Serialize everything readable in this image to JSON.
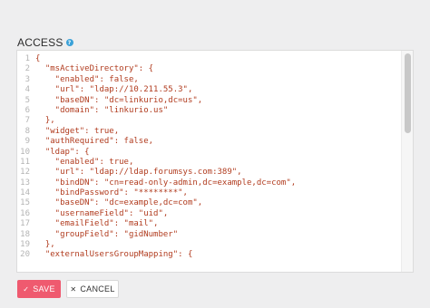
{
  "section": {
    "title": "ACCESS",
    "help_icon": "?"
  },
  "editor": {
    "lines": [
      {
        "n": "1",
        "text": "{"
      },
      {
        "n": "2",
        "text": "  \"msActiveDirectory\": {"
      },
      {
        "n": "3",
        "text": "    \"enabled\": false,"
      },
      {
        "n": "4",
        "text": "    \"url\": \"ldap://10.211.55.3\","
      },
      {
        "n": "5",
        "text": "    \"baseDN\": \"dc=linkurio,dc=us\","
      },
      {
        "n": "6",
        "text": "    \"domain\": \"linkurio.us\""
      },
      {
        "n": "7",
        "text": "  },"
      },
      {
        "n": "8",
        "text": "  \"widget\": true,"
      },
      {
        "n": "9",
        "text": "  \"authRequired\": false,"
      },
      {
        "n": "10",
        "text": "  \"ldap\": {"
      },
      {
        "n": "11",
        "text": "    \"enabled\": true,"
      },
      {
        "n": "12",
        "text": "    \"url\": \"ldap://ldap.forumsys.com:389\","
      },
      {
        "n": "13",
        "text": "    \"bindDN\": \"cn=read-only-admin,dc=example,dc=com\","
      },
      {
        "n": "14",
        "text": "    \"bindPassword\": \"********\","
      },
      {
        "n": "15",
        "text": "    \"baseDN\": \"dc=example,dc=com\","
      },
      {
        "n": "16",
        "text": "    \"usernameField\": \"uid\","
      },
      {
        "n": "17",
        "text": "    \"emailField\": \"mail\","
      },
      {
        "n": "18",
        "text": "    \"groupField\": \"gidNumber\""
      },
      {
        "n": "19",
        "text": "  },"
      },
      {
        "n": "20",
        "text": "  \"externalUsersGroupMapping\": {"
      }
    ]
  },
  "buttons": {
    "save": {
      "icon": "check-icon",
      "glyph": "✓",
      "label": "SAVE"
    },
    "cancel": {
      "icon": "close-icon",
      "glyph": "✕",
      "label": "CANCEL"
    }
  },
  "colors": {
    "save_bg": "#ef5a6f",
    "code_text": "#b13c1f",
    "help_icon": "#3aa1d8"
  }
}
